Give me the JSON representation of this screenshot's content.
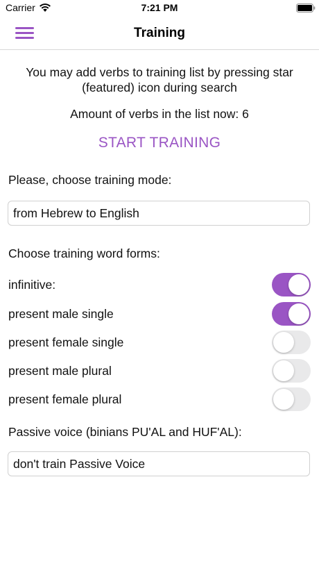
{
  "status_bar": {
    "carrier": "Carrier",
    "time": "7:21 PM"
  },
  "nav": {
    "title": "Training",
    "menu_icon": "hamburger-menu-icon"
  },
  "info_text": "You may add verbs to training list by pressing star (featured) icon during search",
  "verb_count_text": "Amount of verbs in the list now: 6",
  "start_button_label": "START TRAINING",
  "mode": {
    "label": "Please, choose training mode:",
    "selected_value": "from Hebrew to English"
  },
  "word_forms": {
    "label": "Choose training word forms:",
    "items": [
      {
        "label": "infinitive:",
        "enabled": true
      },
      {
        "label": "present male single",
        "enabled": true
      },
      {
        "label": "present female single",
        "enabled": false
      },
      {
        "label": "present male plural",
        "enabled": false
      },
      {
        "label": "present female plural",
        "enabled": false
      }
    ]
  },
  "passive": {
    "label": "Passive voice (binians PU'AL and HUF'AL):",
    "selected_value": "don't train Passive Voice"
  },
  "colors": {
    "accent": "#9a55c4",
    "toggle_off": "#e9e9ea",
    "divider": "#d8d8d8"
  }
}
